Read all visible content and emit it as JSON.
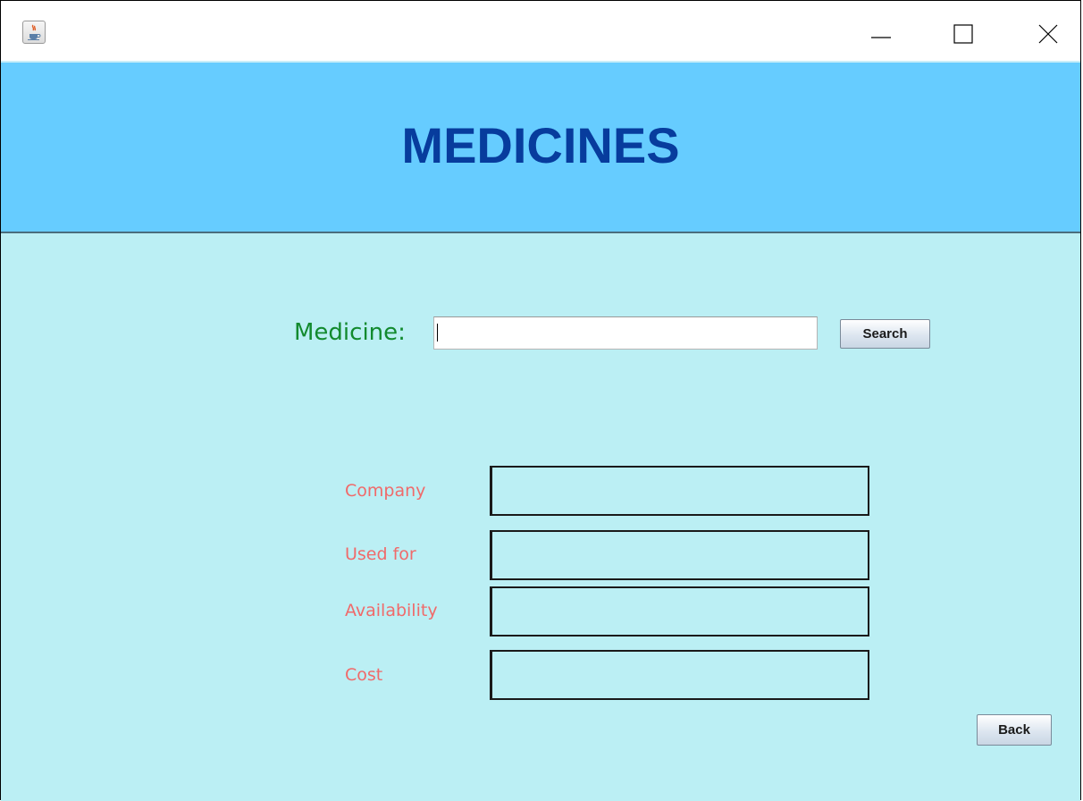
{
  "window": {
    "minimize_glyph": "—",
    "colors": {
      "header_bg": "#66ccff",
      "content_bg": "#bbeff4",
      "title": "#073c9d",
      "medicine_label": "#128a2e",
      "field_label": "#f06a6a"
    }
  },
  "header": {
    "title": "MEDICINES"
  },
  "search": {
    "label": "Medicine:",
    "value": "",
    "button_label": "Search"
  },
  "fields": [
    {
      "label": "Company",
      "value": ""
    },
    {
      "label": "Used for",
      "value": ""
    },
    {
      "label": "Availability",
      "value": ""
    },
    {
      "label": "Cost",
      "value": ""
    }
  ],
  "back_button_label": "Back",
  "icons": {
    "app": "java-cup-icon",
    "minimize": "minimize-icon",
    "maximize": "maximize-icon",
    "close": "close-icon"
  }
}
